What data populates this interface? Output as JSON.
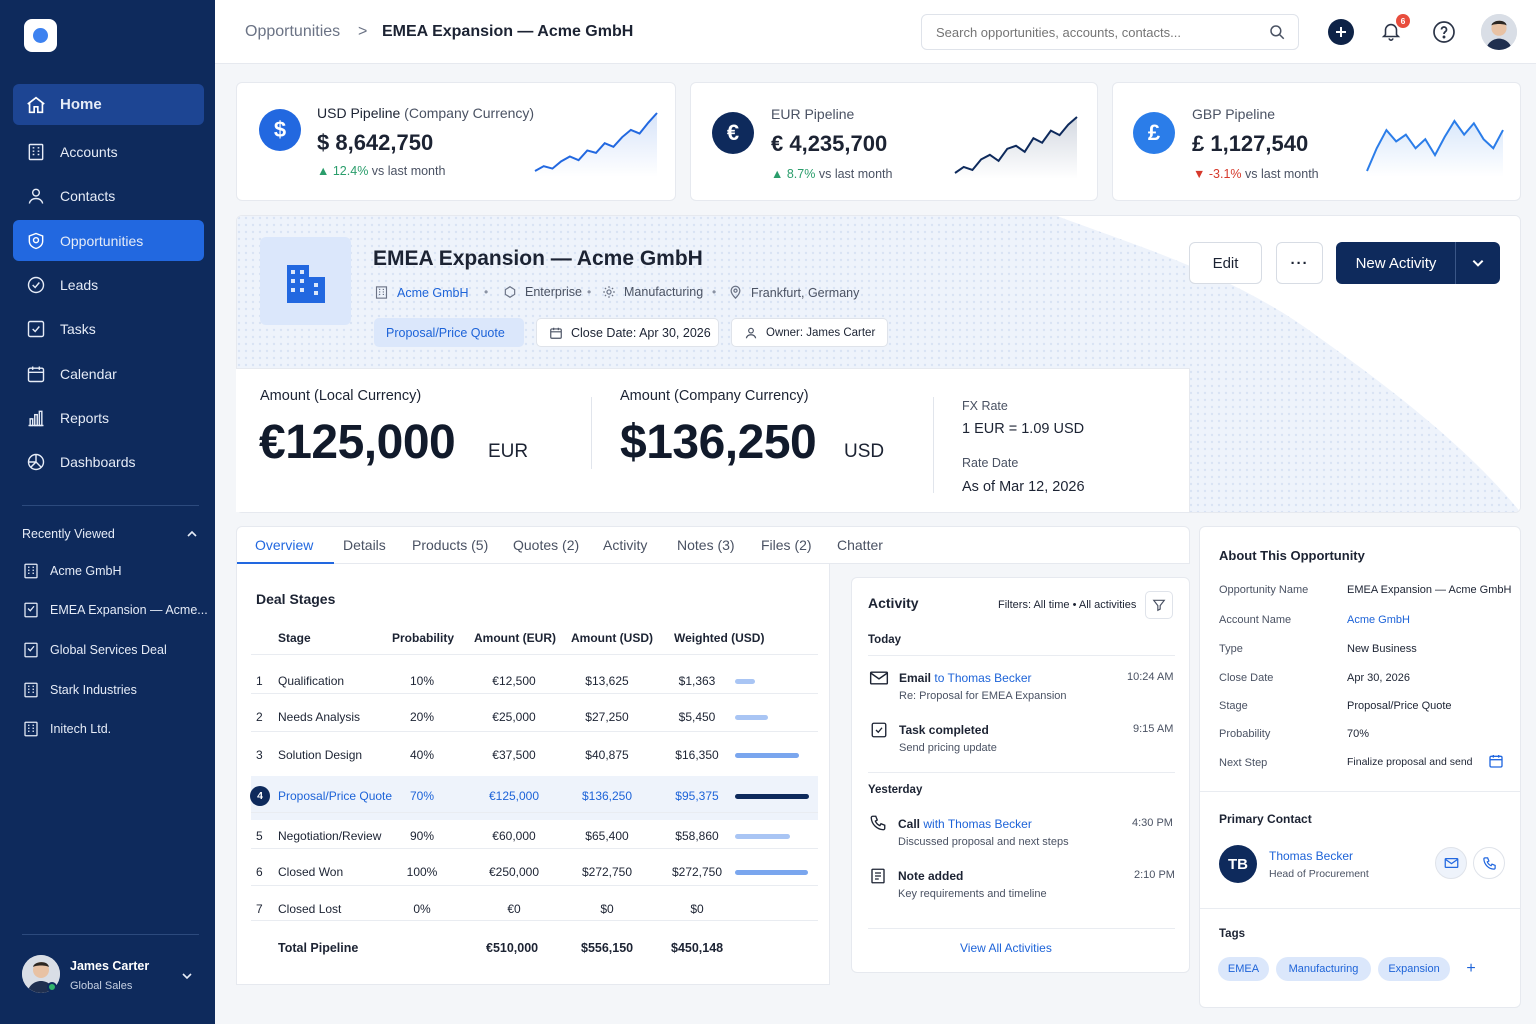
{
  "sidebar": {
    "nav": [
      {
        "label": "Home",
        "icon": "home-icon"
      },
      {
        "label": "Accounts",
        "icon": "accounts-icon"
      },
      {
        "label": "Contacts",
        "icon": "contacts-icon"
      },
      {
        "label": "Opportunities",
        "icon": "opportunities-icon"
      },
      {
        "label": "Leads",
        "icon": "leads-icon"
      },
      {
        "label": "Tasks",
        "icon": "tasks-icon"
      },
      {
        "label": "Calendar",
        "icon": "calendar-icon"
      },
      {
        "label": "Reports",
        "icon": "reports-icon"
      },
      {
        "label": "Dashboards",
        "icon": "dashboards-icon"
      }
    ],
    "recently_viewed_title": "Recently Viewed",
    "recently_viewed": [
      "Acme GmbH",
      "EMEA Expansion — Acme...",
      "Global Services Deal",
      "Stark Industries",
      "Initech Ltd."
    ],
    "user": {
      "name": "James Carter",
      "role": "Global Sales"
    }
  },
  "topbar": {
    "breadcrumb_parent": "Opportunities",
    "breadcrumb_sep": ">",
    "breadcrumb_current": "EMEA Expansion — Acme GmbH",
    "search_placeholder": "Search opportunities, accounts, contacts...",
    "notification_count": "6"
  },
  "kpis": [
    {
      "currency": "USD",
      "label": "Pipeline",
      "sublabel": "(Company Currency)",
      "symbol": "$",
      "value": "$ 8,642,750",
      "change": "12.4%",
      "change_suffix": "vs last month",
      "direction": "up",
      "spark": [
        10,
        14,
        12,
        18,
        22,
        19,
        27,
        25,
        33,
        30,
        38,
        44,
        41,
        50,
        58
      ]
    },
    {
      "currency": "EUR",
      "label": "Pipeline",
      "sublabel": "",
      "symbol": "€",
      "value": "€ 4,235,700",
      "change": "8.7%",
      "change_suffix": "vs last month",
      "direction": "up",
      "spark": [
        8,
        12,
        10,
        17,
        20,
        16,
        24,
        26,
        22,
        31,
        28,
        36,
        33,
        40,
        45
      ]
    },
    {
      "currency": "GBP",
      "label": "Pipeline",
      "sublabel": "",
      "symbol": "£",
      "value": "£ 1,127,540",
      "change": "-3.1%",
      "change_suffix": "vs last month",
      "direction": "down",
      "spark": [
        20,
        30,
        38,
        33,
        36,
        30,
        34,
        27,
        35,
        42,
        36,
        41,
        34,
        30,
        38
      ]
    }
  ],
  "opportunity": {
    "title": "EMEA Expansion — Acme GmbH",
    "account": "Acme GmbH",
    "segment": "Enterprise",
    "industry": "Manufacturing",
    "location": "Frankfurt, Germany",
    "stage_chip": "Proposal/Price Quote",
    "close_chip": "Close Date: Apr 30, 2026",
    "owner_chip": "Owner: James Carter",
    "buttons": {
      "edit": "Edit",
      "more": "···",
      "new_activity": "New Activity"
    }
  },
  "amounts": {
    "local_label": "Amount (Local Currency)",
    "local_value": "€125,000",
    "local_currency": "EUR",
    "company_label": "Amount (Company Currency)",
    "company_value": "$136,250",
    "company_currency": "USD",
    "fx_label": "FX Rate",
    "fx_value": "1 EUR = 1.09 USD",
    "rate_date_label": "Rate Date",
    "rate_date_value": "As of Mar 12, 2026"
  },
  "tabs": [
    "Overview",
    "Details",
    "Products (5)",
    "Quotes (2)",
    "Activity",
    "Notes (3)",
    "Files (2)",
    "Chatter"
  ],
  "deal_stages": {
    "title": "Deal Stages",
    "headers": [
      "Stage",
      "Probability",
      "Amount (EUR)",
      "Amount (USD)",
      "Weighted (USD)"
    ],
    "rows": [
      {
        "n": "1",
        "stage": "Qualification",
        "prob": "10%",
        "eur": "€12,500",
        "usd": "$13,625",
        "weighted": "$1,363",
        "share": 0.27
      },
      {
        "n": "2",
        "stage": "Needs Analysis",
        "prob": "20%",
        "eur": "€25,000",
        "usd": "$27,250",
        "weighted": "$5,450",
        "share": 0.45
      },
      {
        "n": "3",
        "stage": "Solution Design",
        "prob": "40%",
        "eur": "€37,500",
        "usd": "$40,875",
        "weighted": "$16,350",
        "share": 0.86
      },
      {
        "n": "4",
        "stage": "Proposal/Price Quote",
        "prob": "70%",
        "eur": "€125,000",
        "usd": "$136,250",
        "weighted": "$95,375",
        "share": 1.0
      },
      {
        "n": "5",
        "stage": "Negotiation/Review",
        "prob": "90%",
        "eur": "€60,000",
        "usd": "$65,400",
        "weighted": "$58,860",
        "share": 0.74
      },
      {
        "n": "6",
        "stage": "Closed Won",
        "prob": "100%",
        "eur": "€250,000",
        "usd": "$272,750",
        "weighted": "$272,750",
        "share": 0.99
      },
      {
        "n": "7",
        "stage": "Closed Lost",
        "prob": "0%",
        "eur": "€0",
        "usd": "$0",
        "weighted": "$0",
        "share": 0
      }
    ],
    "total_label": "Total Pipeline",
    "total_eur": "€510,000",
    "total_usd": "$556,150",
    "total_weighted": "$450,148"
  },
  "activity": {
    "title": "Activity",
    "filters": "Filters: All time • All activities",
    "today": "Today",
    "yesterday": "Yesterday",
    "items": [
      {
        "type": "Email",
        "with": "to Thomas Becker",
        "sub": "Re: Proposal for EMEA Expansion",
        "time": "10:24 AM"
      },
      {
        "type": "Task completed",
        "with": "",
        "sub": "Send pricing update",
        "time": "9:15 AM"
      },
      {
        "type": "Call",
        "with": "with Thomas Becker",
        "sub": "Discussed proposal and next steps",
        "time": "4:30 PM"
      },
      {
        "type": "Note added",
        "with": "",
        "sub": "Key requirements and timeline",
        "time": "2:10 PM"
      }
    ],
    "view_all": "View All Activities"
  },
  "about": {
    "title": "About This Opportunity",
    "fields": [
      {
        "k": "Opportunity Name",
        "v": "EMEA Expansion — Acme GmbH"
      },
      {
        "k": "Account Name",
        "v": "Acme GmbH"
      },
      {
        "k": "Type",
        "v": "New Business"
      },
      {
        "k": "Close Date",
        "v": "Apr 30, 2026"
      },
      {
        "k": "Stage",
        "v": "Proposal/Price Quote"
      },
      {
        "k": "Probability",
        "v": "70%"
      },
      {
        "k": "Next Step",
        "v": "Finalize proposal and send"
      }
    ],
    "primary_contact_title": "Primary Contact",
    "contact": {
      "initials": "TB",
      "name": "Thomas Becker",
      "role": "Head of Procurement"
    },
    "tags_title": "Tags",
    "tags": [
      "EMEA",
      "Manufacturing",
      "Expansion"
    ]
  },
  "colors": {
    "sidebar": "#0e2a5c",
    "accent": "#2268e0",
    "navy": "#0e2a5c",
    "up": "#2a9d6b",
    "down": "#d6392c"
  }
}
